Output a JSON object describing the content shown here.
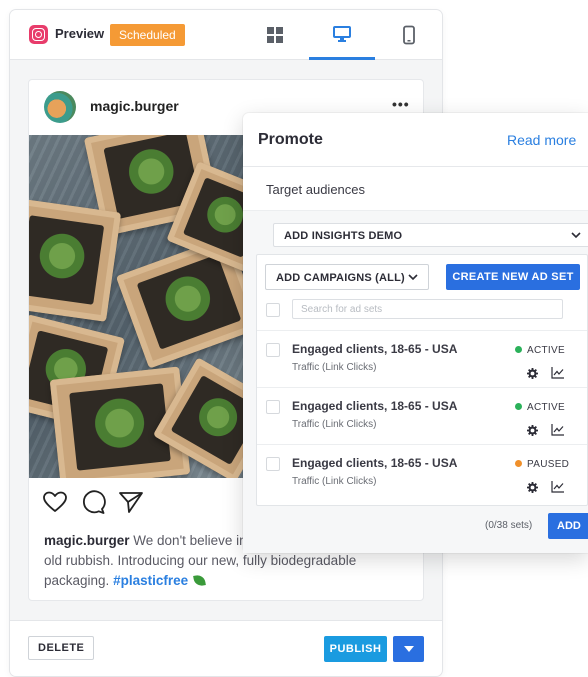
{
  "preview": {
    "title": "Preview",
    "status_badge": "Scheduled",
    "accent_color": "#2a7fe0",
    "badge_color": "#f59a35",
    "view_modes": [
      "grid-view-icon",
      "desktop-view-icon",
      "mobile-view-icon"
    ],
    "active_view": "desktop"
  },
  "post": {
    "username": "magic.burger",
    "more_label": "•••",
    "caption_user": "magic.burger",
    "caption_text": " We don't believe in putting our burgers in any old rubbish. Introducing our new, fully biodegradable packaging. ",
    "hashtag": "#plasticfree",
    "actions": [
      "heart-icon",
      "comment-icon",
      "share-icon"
    ]
  },
  "footer": {
    "delete_label": "DELETE",
    "publish_label": "PUBLISH"
  },
  "promote": {
    "title": "Promote",
    "read_more": "Read more",
    "target_audiences": "Target audiences",
    "insights_select": "ADD INSIGHTS DEMO",
    "campaigns_select": "ADD CAMPAIGNS (ALL)",
    "create_button": "CREATE NEW AD SET",
    "search_placeholder": "Search for ad sets",
    "ad_sets": [
      {
        "name": "Engaged clients, 18-65 - USA",
        "objective": "Traffic (Link Clicks)",
        "status": "ACTIVE",
        "status_color": "#2bb15a"
      },
      {
        "name": "Engaged clients, 18-65 - USA",
        "objective": "Traffic (Link Clicks)",
        "status": "ACTIVE",
        "status_color": "#2bb15a"
      },
      {
        "name": "Engaged clients, 18-65 - USA",
        "objective": "Traffic (Link Clicks)",
        "status": "PAUSED",
        "status_color": "#f0902a"
      }
    ],
    "sets_count": "(0/38 sets)",
    "add_button": "ADD"
  }
}
